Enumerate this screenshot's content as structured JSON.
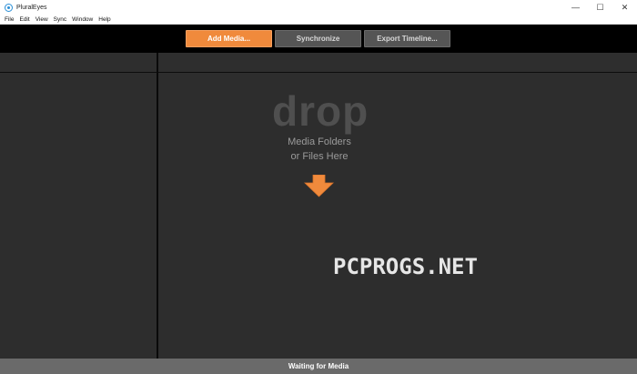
{
  "window": {
    "title": "PluralEyes",
    "minimize_glyph": "—",
    "maximize_glyph": "☐",
    "close_glyph": "✕"
  },
  "menu": [
    "File",
    "Edit",
    "View",
    "Sync",
    "Window",
    "Help"
  ],
  "toolbar": {
    "add_media_label": "Add Media...",
    "synchronize_label": "Synchronize",
    "export_timeline_label": "Export Timeline..."
  },
  "drop_zone": {
    "headline": "drop",
    "line1": "Media Folders",
    "line2": "or Files Here",
    "arrow_icon": "arrow-down-icon"
  },
  "watermark": "PCPROGS.NET",
  "status": {
    "text": "Waiting for Media"
  },
  "colors": {
    "accent": "#f08a3c",
    "button_secondary": "#555555",
    "panel_bg": "#2d2d2d",
    "toolbar_bg": "#000000",
    "statusbar_bg": "#6a6a6a"
  }
}
